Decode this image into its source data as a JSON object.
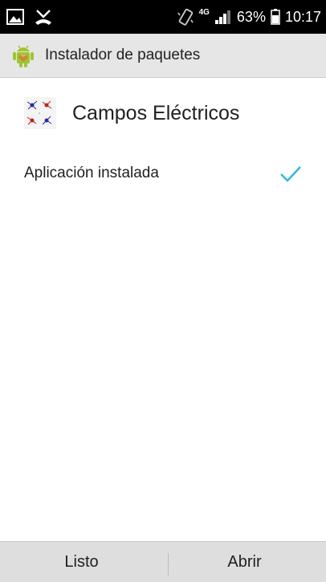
{
  "status_bar": {
    "network": "4G",
    "battery": "63%",
    "time": "10:17",
    "icons": [
      "gallery-icon",
      "missed-call-icon",
      "vibrate-icon",
      "signal-icon",
      "battery-icon"
    ]
  },
  "header": {
    "title": "Instalador de paquetes",
    "icon": "android-icon",
    "background": "#e6e6e6"
  },
  "app": {
    "name": "Campos Eléctricos",
    "icon": "app-icon"
  },
  "status": {
    "text": "Aplicación instalada",
    "icon": "checkmark-icon",
    "check_color": "#33b5e5"
  },
  "footer": {
    "done_label": "Listo",
    "open_label": "Abrir"
  }
}
